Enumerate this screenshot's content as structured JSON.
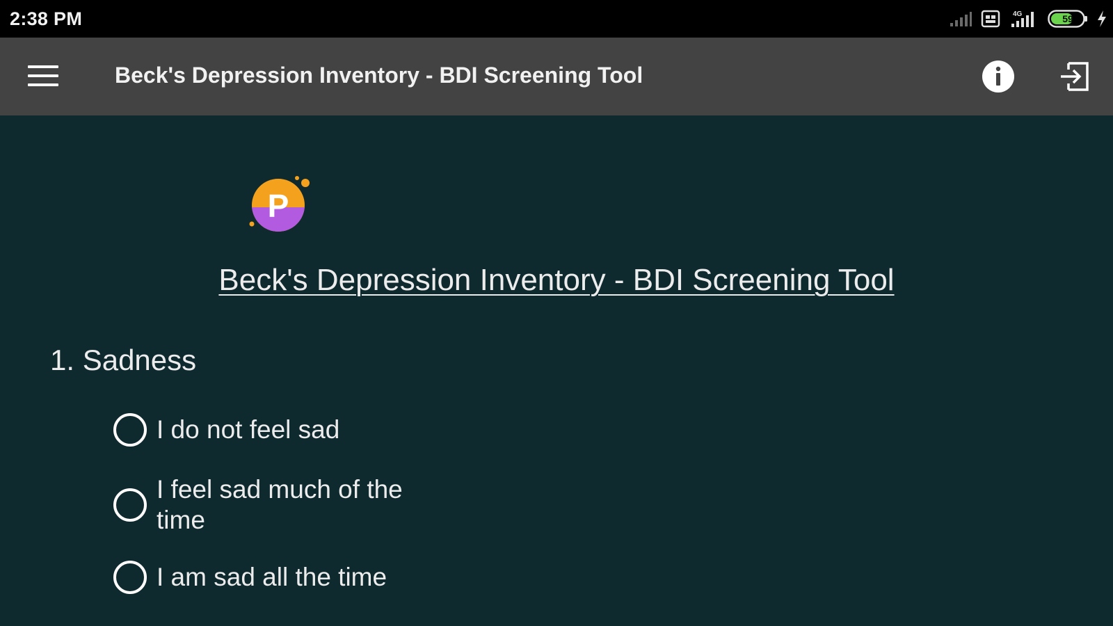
{
  "status_bar": {
    "time": "2:38 PM",
    "battery_level": "59",
    "icons": [
      "signal-weak-icon",
      "sim-icon",
      "network-4g-signal-icon",
      "battery-icon",
      "charging-bolt-icon"
    ]
  },
  "toolbar": {
    "title": "Beck's Depression Inventory - BDI Screening Tool",
    "icons": [
      "hamburger-menu-icon",
      "info-icon",
      "exit-icon"
    ]
  },
  "content": {
    "logo_letter": "P",
    "heading": "Beck's Depression Inventory - BDI Screening Tool",
    "question": "1. Sadness",
    "options": [
      "I do not feel sad",
      "I feel sad much of the time",
      "I am sad all the time"
    ]
  },
  "colors": {
    "status_bar_bg": "#000000",
    "toolbar_bg": "#434343",
    "page_bg": "#0f2a2f",
    "logo_orange": "#f4a21e",
    "logo_purple": "#b35be0",
    "battery_green": "#6ad24c"
  }
}
